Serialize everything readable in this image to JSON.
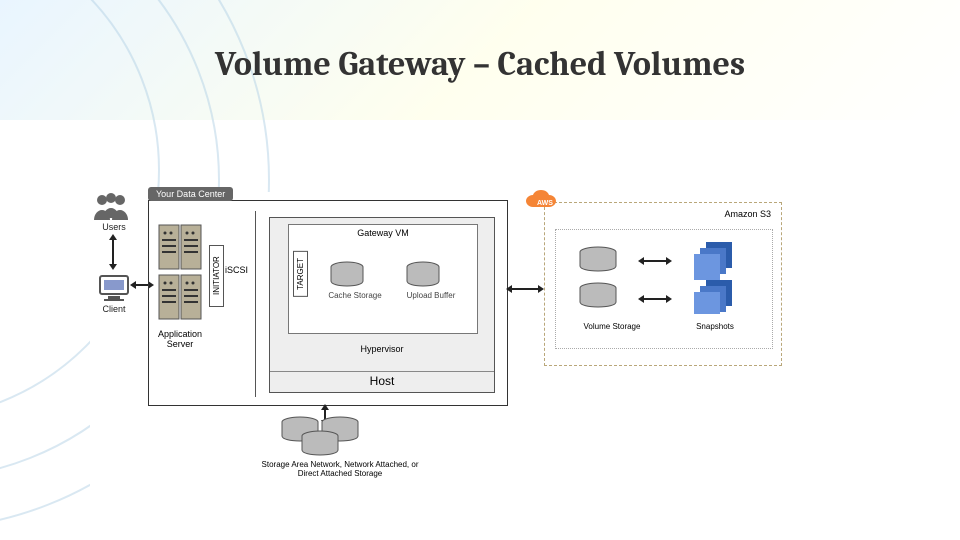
{
  "title": "Volume Gateway – Cached Volumes",
  "diagram": {
    "users": "Users",
    "client": "Client",
    "data_center_label": "Your Data Center",
    "initiator": "INITIATOR",
    "iscsi": "iSCSI",
    "app_server": "Application Server",
    "gateway_vm": "Gateway VM",
    "target": "TARGET",
    "cache_storage": "Cache Storage",
    "upload_buffer": "Upload Buffer",
    "hypervisor": "Hypervisor",
    "host": "Host",
    "san": "Storage Area Network, Network Attached, or Direct Attached Storage",
    "aws": "AWS",
    "s3": "Amazon S3",
    "volume_storage": "Volume Storage",
    "snapshots": "Snapshots"
  }
}
